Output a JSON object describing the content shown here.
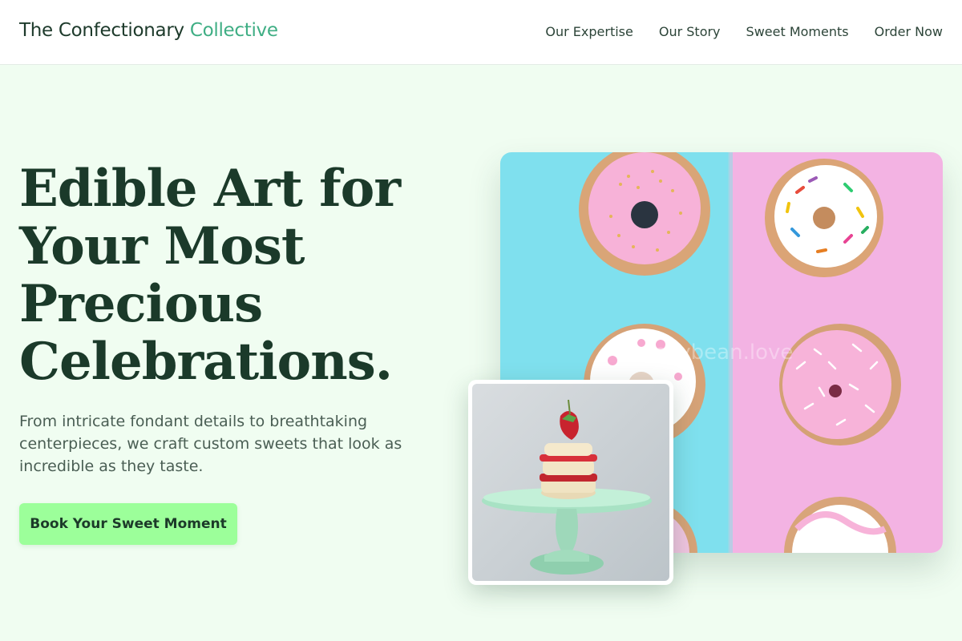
{
  "header": {
    "brand_main": "The Confectionary",
    "brand_accent": "Collective",
    "nav": [
      "Our Expertise",
      "Our Story",
      "Sweet Moments",
      "Order Now"
    ]
  },
  "hero": {
    "title_lines": [
      "Edible Art for",
      "Your Most",
      "Precious",
      "Celebrations."
    ],
    "subtitle": "From intricate fondant details to breathtaking centerpieces, we craft custom sweets that look as incredible as they taste.",
    "cta_label": "Book Your Sweet Moment"
  },
  "images": {
    "main_alt": "donuts on blue and pink background",
    "main_watermark": "jellybean.love",
    "inset_alt": "strawberry shortcake on green cake stand"
  },
  "colors": {
    "accent": "#3fae84",
    "cta_bg": "#9cff9a",
    "page_bg": "#f0fdf1",
    "heading": "#1b3a2a"
  }
}
